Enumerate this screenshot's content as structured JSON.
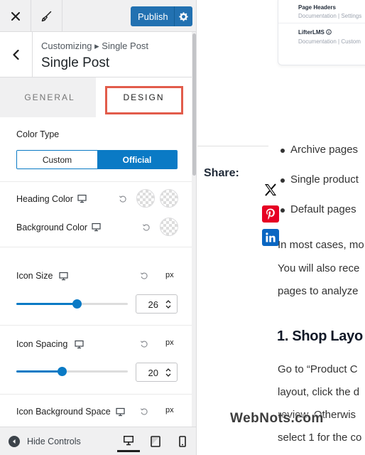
{
  "topbar": {
    "publish_label": "Publish"
  },
  "panel": {
    "breadcrumb": "Customizing ▸ Single Post",
    "title": "Single Post"
  },
  "tabs": {
    "general": "GENERAL",
    "design": "DESIGN"
  },
  "design": {
    "color_type": {
      "label": "Color Type",
      "options": [
        "Custom",
        "Official"
      ],
      "selected": "Official"
    },
    "heading_color": {
      "label": "Heading Color"
    },
    "background_color": {
      "label": "Background Color"
    },
    "icon_size": {
      "label": "Icon Size",
      "unit": "px",
      "value": "26",
      "fraction": 0.54
    },
    "icon_spacing": {
      "label": "Icon Spacing",
      "unit": "px",
      "value": "20",
      "fraction": 0.41
    },
    "icon_background_space": {
      "label": "Icon Background Space",
      "unit": "px"
    }
  },
  "footer": {
    "hide_controls": "Hide Controls"
  },
  "preview": {
    "card": {
      "page_headers": "Page Headers",
      "page_headers_links": "Documentation | Settings",
      "lifterlms": "LifterLMS",
      "lifterlms_links": "Documentation | Custom"
    },
    "share_label": "Share:",
    "bullets": [
      "Archive pages",
      "Single product",
      "Default pages"
    ],
    "paragraph_lines": [
      "In most cases, mo",
      "You will also rece",
      "pages to analyze"
    ],
    "heading": "1. Shop Layo",
    "paragraph2_lines": [
      "Go to “Product C",
      "layout, click the d",
      "review. Otherwis",
      "select 1 for the co"
    ],
    "watermark": "WebNots.com"
  },
  "colors": {
    "accent": "#0a7ac5",
    "publish": "#2271b1",
    "highlight": "#e25c4b",
    "pinterest": "#e60023",
    "linkedin": "#0a66c2"
  }
}
